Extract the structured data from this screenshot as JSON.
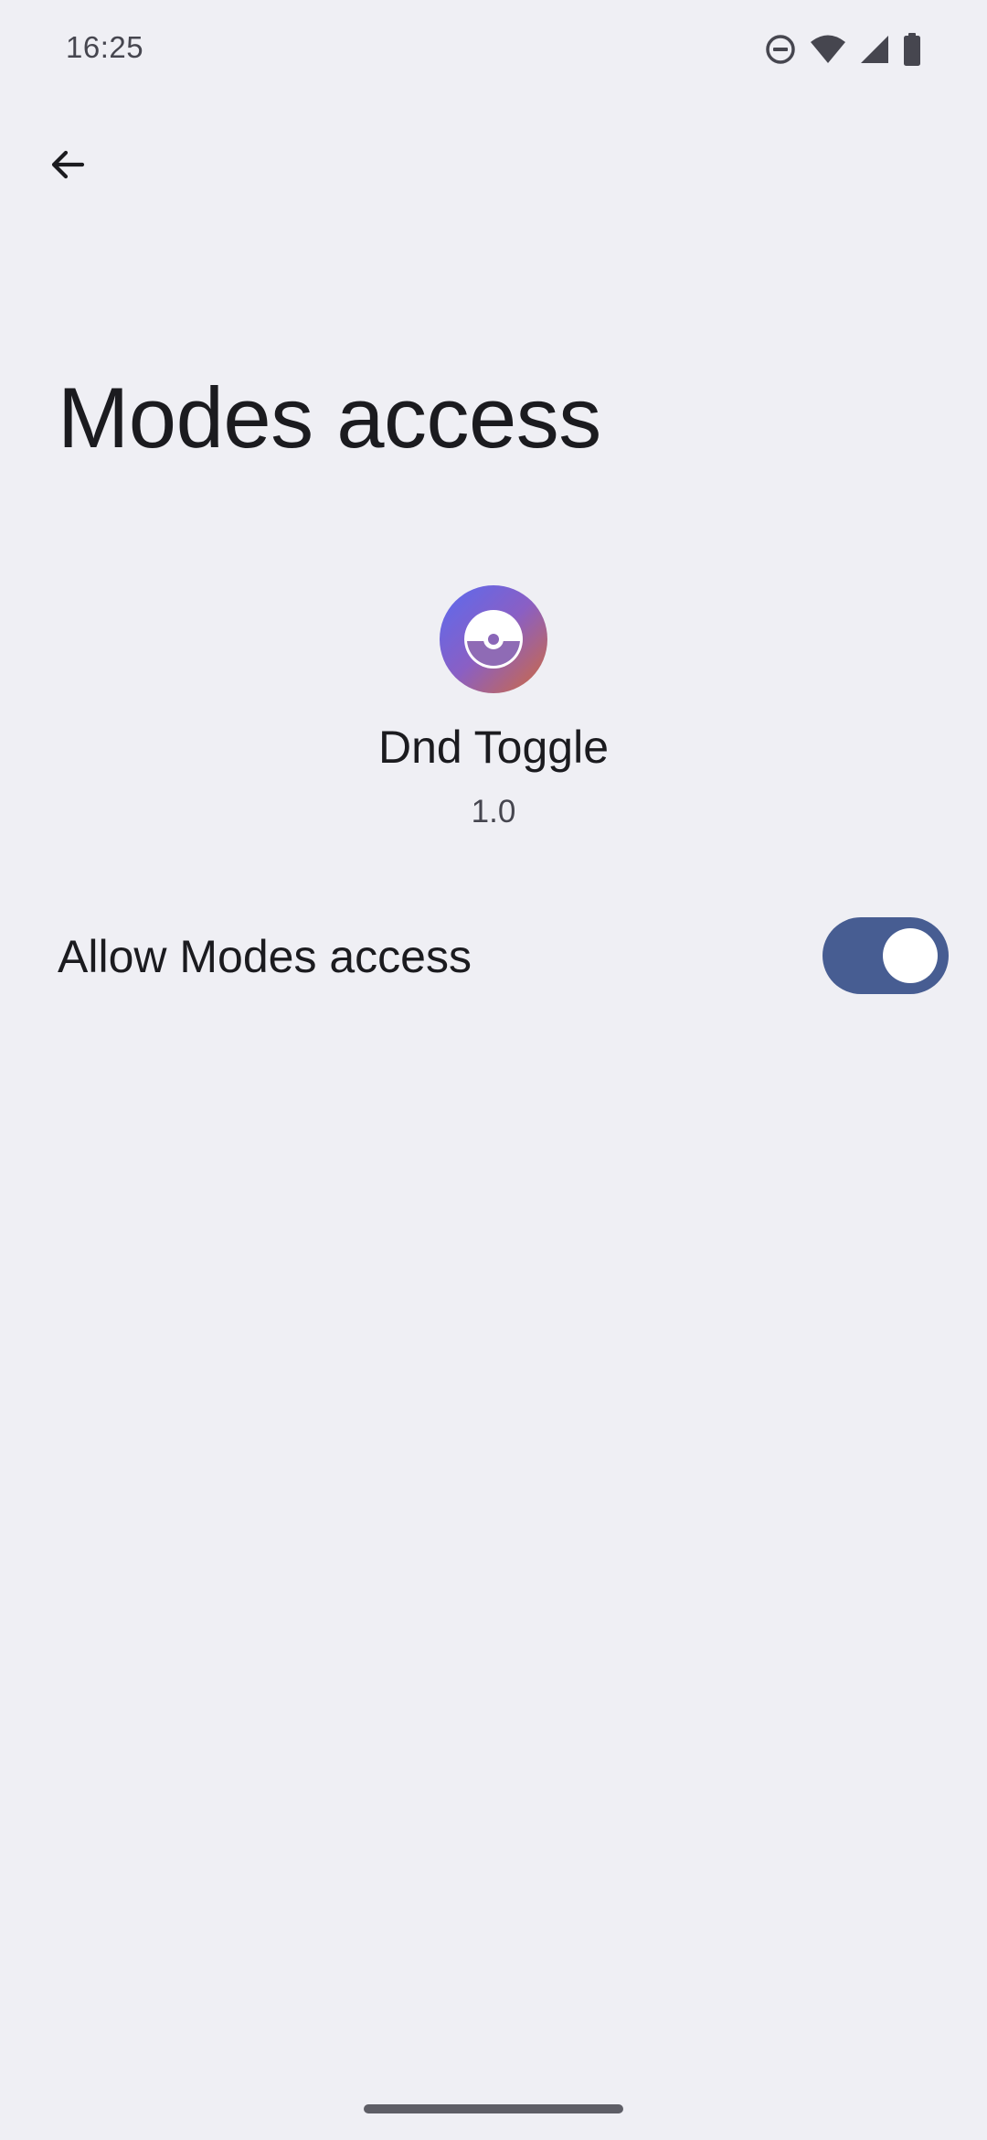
{
  "status_bar": {
    "time": "16:25",
    "icons": [
      "do-not-disturb-icon",
      "wifi-icon",
      "cellular-signal-icon",
      "battery-icon"
    ]
  },
  "app_bar": {
    "back_icon": "arrow-back-icon"
  },
  "page": {
    "title": "Modes access"
  },
  "app": {
    "name": "Dnd Toggle",
    "version": "1.0",
    "icon": "app-icon"
  },
  "toggle": {
    "label": "Allow Modes access",
    "checked": true
  },
  "colors": {
    "background": "#efeff4",
    "switch_track_on": "#475d92",
    "switch_thumb": "#ffffff",
    "text_primary": "#1b1b1f",
    "text_secondary": "#46464f"
  }
}
